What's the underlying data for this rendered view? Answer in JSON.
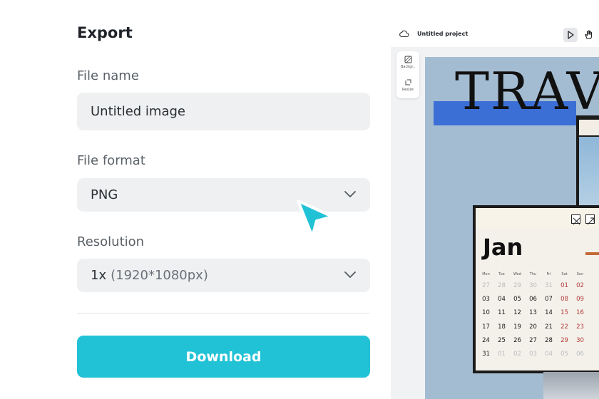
{
  "export": {
    "title": "Export",
    "file_name": {
      "label": "File name",
      "value": "Untitled image"
    },
    "file_format": {
      "label": "File format",
      "value": "PNG"
    },
    "resolution": {
      "label": "Resolution",
      "value_main": "1x",
      "value_sub": "(1920*1080px)"
    },
    "download_label": "Download"
  },
  "editor": {
    "project_title": "Untitled project",
    "tools": {
      "background_label": "Backgr..",
      "resize_label": "Resize"
    },
    "canvas": {
      "headline": "TRAV",
      "calendar": {
        "month": "Jan",
        "weekdays": [
          "Mon",
          "Tue",
          "Wed",
          "Thu",
          "Fri",
          "Sat",
          "Sun"
        ],
        "weeks": [
          [
            "27",
            "28",
            "29",
            "30",
            "31",
            "01",
            "02"
          ],
          [
            "03",
            "04",
            "05",
            "06",
            "07",
            "08",
            "09"
          ],
          [
            "10",
            "11",
            "12",
            "13",
            "14",
            "15",
            "16"
          ],
          [
            "17",
            "18",
            "19",
            "20",
            "21",
            "22",
            "23"
          ],
          [
            "24",
            "25",
            "26",
            "27",
            "28",
            "29",
            "30"
          ],
          [
            "31",
            "01",
            "02",
            "03",
            "04",
            "05",
            "06"
          ]
        ]
      }
    }
  },
  "colors": {
    "accent": "#22c2d6",
    "field_bg": "#eef0f2",
    "canvas_bg": "#a4bcd2",
    "band": "#3b6fd6",
    "weekend": "#b23a3a"
  }
}
